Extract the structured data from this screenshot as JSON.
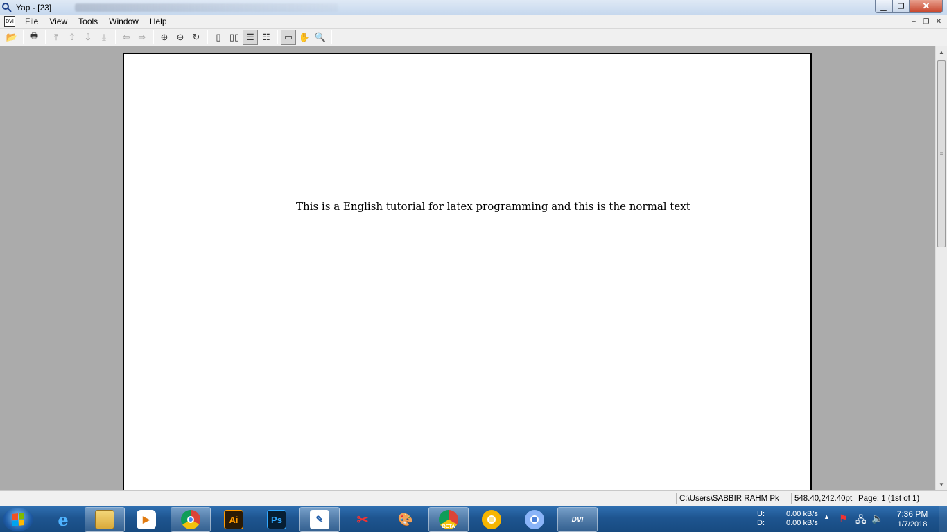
{
  "window": {
    "title": "Yap - [23]",
    "controls": {
      "minimize": "▁",
      "maximize": "❐",
      "close": "✕"
    }
  },
  "menubar": {
    "doc_icon_text": "DVI",
    "items": [
      {
        "label": "File"
      },
      {
        "label": "View"
      },
      {
        "label": "Tools"
      },
      {
        "label": "Window"
      },
      {
        "label": "Help"
      }
    ]
  },
  "toolbar": {
    "buttons": [
      {
        "name": "open-icon",
        "glyph": "📂"
      },
      {
        "name": "print-icon",
        "glyph": "🖶"
      },
      {
        "name": "first-page-icon",
        "glyph": "⤒"
      },
      {
        "name": "previous-page-icon",
        "glyph": "⇧"
      },
      {
        "name": "next-page-icon",
        "glyph": "⇩"
      },
      {
        "name": "last-page-icon",
        "glyph": "⤓"
      },
      {
        "name": "back-icon",
        "glyph": "⇦"
      },
      {
        "name": "forward-icon",
        "glyph": "⇨"
      },
      {
        "name": "zoom-in-icon",
        "glyph": "⊕"
      },
      {
        "name": "zoom-out-icon",
        "glyph": "⊖"
      },
      {
        "name": "refresh-icon",
        "glyph": "↻"
      },
      {
        "name": "single-page-icon",
        "glyph": "▯"
      },
      {
        "name": "double-page-icon",
        "glyph": "▯▯"
      },
      {
        "name": "continuous-icon",
        "glyph": "☰"
      },
      {
        "name": "continuous-double-icon",
        "glyph": "☷"
      },
      {
        "name": "ruler-icon",
        "glyph": "▭"
      },
      {
        "name": "hand-tool-icon",
        "glyph": "✋"
      },
      {
        "name": "magnifier-icon",
        "glyph": "🔍"
      }
    ]
  },
  "document": {
    "body_text": "This is a English tutorial for latex programming and this is the normal text"
  },
  "statusbar": {
    "path": "C:\\Users\\SABBIR RAHM Pk",
    "coordinates": "548.40,242.40pt",
    "page": "Page: 1 (1st of 1)"
  },
  "taskbar": {
    "apps": [
      {
        "name": "ie-icon",
        "label": "e"
      },
      {
        "name": "explorer-icon",
        "label": ""
      },
      {
        "name": "media-player-icon",
        "label": "▶"
      },
      {
        "name": "chrome-icon",
        "label": ""
      },
      {
        "name": "illustrator-icon",
        "label": "Ai"
      },
      {
        "name": "photoshop-icon",
        "label": "Ps"
      },
      {
        "name": "document-pen-icon",
        "label": "✎"
      },
      {
        "name": "snipping-tool-icon",
        "label": "✂"
      },
      {
        "name": "paint-icon",
        "label": "🎨"
      },
      {
        "name": "chrome-beta-icon",
        "label": "BETA"
      },
      {
        "name": "chrome-canary-icon",
        "label": ""
      },
      {
        "name": "chromium-icon",
        "label": ""
      },
      {
        "name": "yap-dvi-icon",
        "label": "DVI"
      }
    ],
    "network": {
      "up_label": "U:",
      "down_label": "D:",
      "up_value": "0.00 kB/s",
      "down_value": "0.00 kB/s"
    },
    "clock": {
      "time": "7:36 PM",
      "date": "1/7/2018"
    }
  }
}
